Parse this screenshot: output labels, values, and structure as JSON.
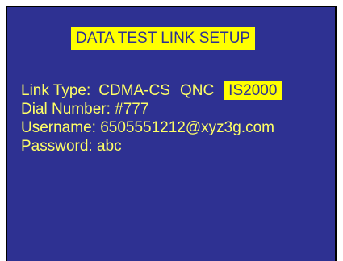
{
  "screen": {
    "title": "DATA TEST LINK SETUP",
    "link_type": {
      "label": "Link Type:",
      "options": [
        "CDMA-CS",
        "QNC",
        "IS2000"
      ],
      "selected": "IS2000"
    },
    "dial_number": "Dial Number: #777",
    "username": "Username: 6505551212@xyz3g.com",
    "password": "Password: abc"
  },
  "colors": {
    "background": "#2e3192",
    "text": "#ffff66",
    "highlight": "#ffff00"
  }
}
